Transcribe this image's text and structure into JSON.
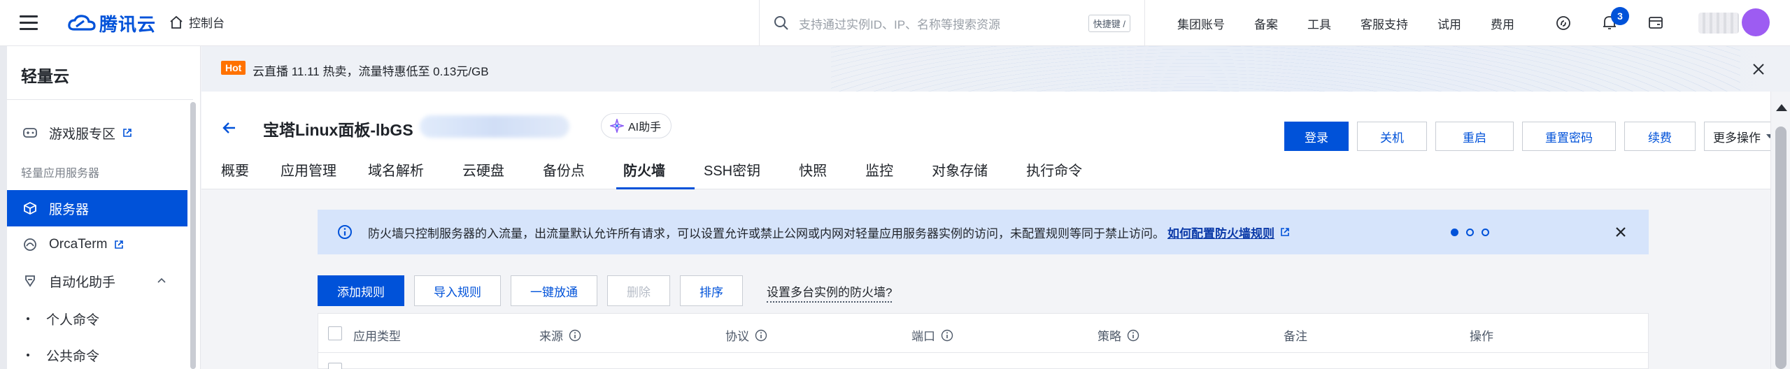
{
  "topbar": {
    "logo_text": "腾讯云",
    "console_label": "控制台",
    "search_placeholder": "支持通过实例ID、IP、名称等搜索资源",
    "search_shortcut": "快捷键 /",
    "nav": [
      "集团账号",
      "备案",
      "工具",
      "客服支持",
      "试用",
      "费用"
    ],
    "notification_count": "3"
  },
  "sidebar": {
    "title": "轻量云",
    "game_zone": "游戏服专区",
    "group_label": "轻量应用服务器",
    "servers": "服务器",
    "orcaterm": "OrcaTerm",
    "automation": "自动化助手",
    "personal_commands": "个人命令",
    "public_commands": "公共命令"
  },
  "banner": {
    "hot_tag": "Hot",
    "text": "云直播 11.11 热卖，流量特惠低至 0.13元/GB"
  },
  "instance": {
    "name": "宝塔Linux面板-lbGS",
    "ai_button": "AI助手",
    "actions": {
      "login": "登录",
      "shutdown": "关机",
      "restart": "重启",
      "reset_password": "重置密码",
      "renew": "续费",
      "more": "更多操作"
    },
    "tabs": [
      "概要",
      "应用管理",
      "域名解析",
      "云硬盘",
      "备份点",
      "防火墙",
      "SSH密钥",
      "快照",
      "监控",
      "对象存储",
      "执行命令"
    ],
    "active_tab": "防火墙"
  },
  "firewall": {
    "info_text": "防火墙只控制服务器的入流量，出流量默认允许所有请求，可以设置允许或禁止公网或内网对轻量应用服务器实例的访问，未配置规则等同于禁止访问。",
    "info_link": "如何配置防火墙规则",
    "toolbar": {
      "add_rule": "添加规则",
      "import_rules": "导入规则",
      "one_click_allow": "一键放通",
      "delete": "删除",
      "sort": "排序",
      "multi_instance": "设置多台实例的防火墙?"
    },
    "columns": [
      "应用类型",
      "来源",
      "协议",
      "端口",
      "策略",
      "备注",
      "操作"
    ]
  },
  "colors": {
    "brand": "#0052d9",
    "hot": "#ff7200",
    "info_bg": "#d6e4fb"
  }
}
